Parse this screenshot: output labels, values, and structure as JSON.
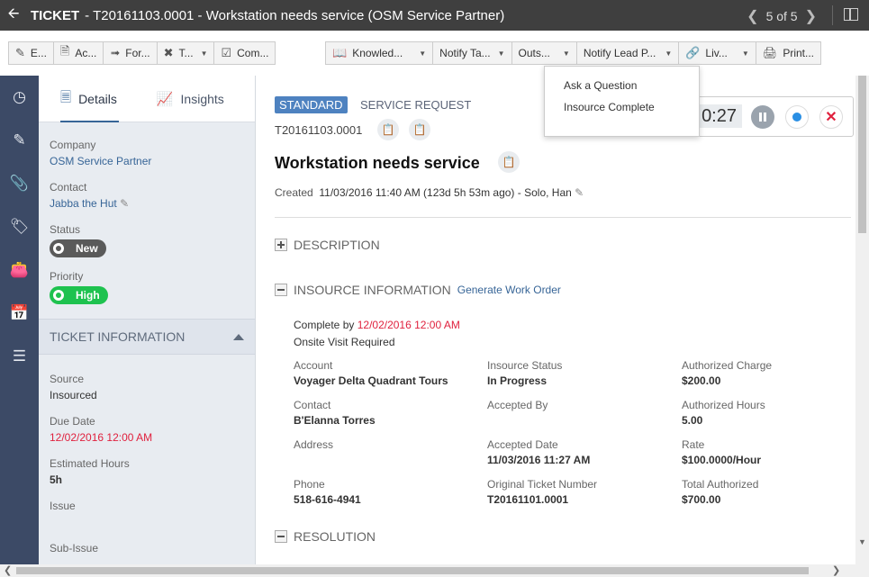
{
  "titlebar": {
    "type": "TICKET",
    "title": "- T20161103.0001 - Workstation needs service (OSM Service Partner)",
    "pager": "5 of 5"
  },
  "toolbar": {
    "group1": [
      "E...",
      "Ac...",
      "For...",
      "T...",
      "Com..."
    ],
    "group2": [
      "Knowled...",
      "Notify Ta...",
      "Outs...",
      "Notify Lead P...",
      "Liv...",
      "Print..."
    ]
  },
  "dropdown": {
    "items": [
      "Ask a Question",
      "Insource Complete"
    ]
  },
  "sidebar": {
    "tabs": [
      "Details",
      "Insights"
    ],
    "company_label": "Company",
    "company": "OSM Service Partner",
    "contact_label": "Contact",
    "contact": "Jabba the Hut",
    "status_label": "Status",
    "status": "New",
    "priority_label": "Priority",
    "priority": "High",
    "section": "TICKET INFORMATION",
    "source_label": "Source",
    "source": "Insourced",
    "due_label": "Due Date",
    "due": "12/02/2016 12:00 AM",
    "est_label": "Estimated Hours",
    "est": "5h",
    "issue_label": "Issue",
    "subissue_label": "Sub-Issue"
  },
  "main": {
    "badge": "STANDARD",
    "category": "SERVICE REQUEST",
    "ticket_number": "T20161103.0001",
    "title": "Workstation needs service",
    "created_label": "Created",
    "created": "11/03/2016 11:40 AM (123d 5h 53m ago)",
    "created_by": "- Solo, Han",
    "timer": "0:27",
    "sec_description": "DESCRIPTION",
    "sec_insource": "INSOURCE INFORMATION",
    "generate": "Generate Work Order",
    "complete_by_label": "Complete by",
    "complete_by": "12/02/2016 12:00 AM",
    "onsite": "Onsite Visit Required",
    "fields": {
      "account_label": "Account",
      "account": "Voyager Delta Quadrant Tours",
      "contact_label": "Contact",
      "contact": "B'Elanna Torres",
      "address_label": "Address",
      "phone_label": "Phone",
      "phone": "518-616-4941",
      "status_label": "Insource Status",
      "status": "In Progress",
      "accepted_by_label": "Accepted By",
      "accepted_date_label": "Accepted Date",
      "accepted_date": "11/03/2016 11:27 AM",
      "orig_label": "Original Ticket Number",
      "orig": "T20161101.0001",
      "charge_label": "Authorized Charge",
      "charge": "$200.00",
      "hours_label": "Authorized Hours",
      "hours": "5.00",
      "rate_label": "Rate",
      "rate": "$100.0000/Hour",
      "total_label": "Total Authorized",
      "total": "$700.00"
    },
    "sec_resolution": "RESOLUTION"
  },
  "colors": {
    "accent": "#376597",
    "nav": "#3c4a66",
    "red": "#e0213e",
    "green": "#1ec24f"
  }
}
